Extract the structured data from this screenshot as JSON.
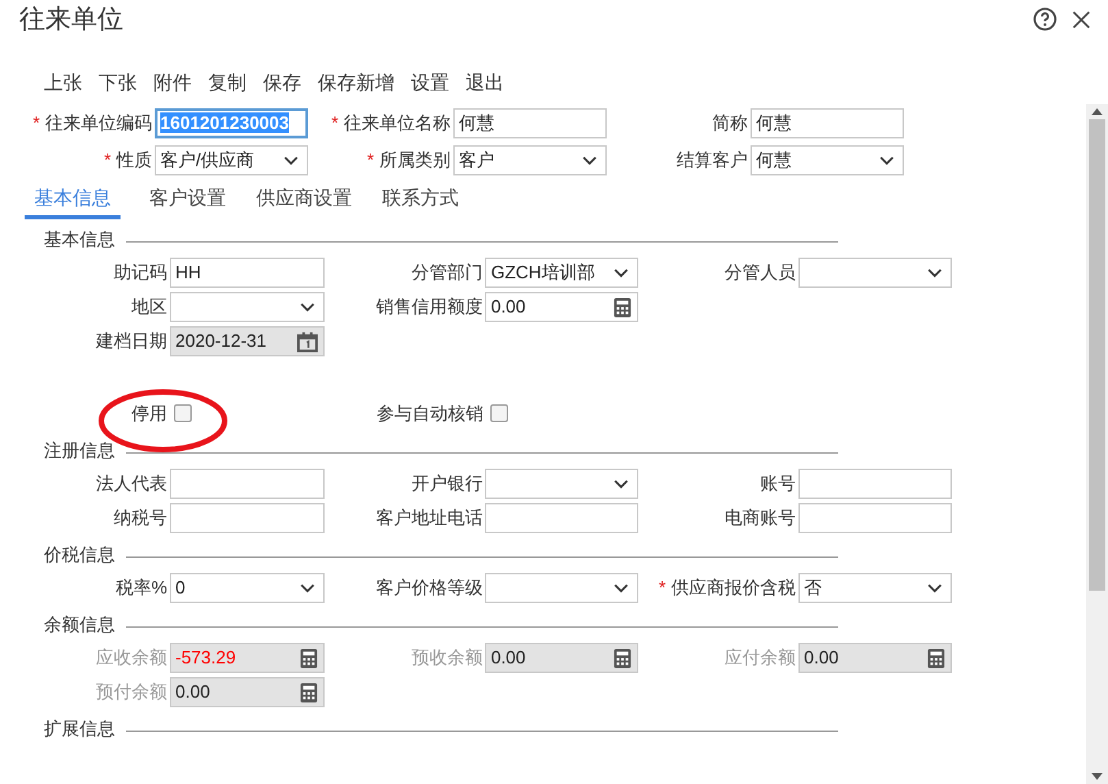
{
  "window": {
    "title": "往来单位"
  },
  "toolbar": [
    "上张",
    "下张",
    "附件",
    "复制",
    "保存",
    "保存新增",
    "设置",
    "退出"
  ],
  "header_rows": [
    [
      {
        "label": "往来单位编码",
        "required_mark": "*",
        "kind": "text",
        "value": "1601201230003",
        "focused": true
      },
      {
        "label": "往来单位名称",
        "required_mark": "*",
        "kind": "text",
        "value": "何慧",
        "focused": false
      },
      {
        "label": "简称",
        "kind": "text",
        "value": "何慧",
        "focused": false
      }
    ],
    [
      {
        "label": "性质",
        "required_mark": "*",
        "kind": "select",
        "value": "客户/供应商",
        "focused": false
      },
      {
        "label": "所属类别",
        "required_mark": "*",
        "kind": "select",
        "value": "客户",
        "focused": false
      },
      {
        "label": "结算客户",
        "kind": "select",
        "value": "何慧",
        "focused": false
      }
    ]
  ],
  "tabs": [
    {
      "label": "基本信息",
      "selected": true
    },
    {
      "label": "客户设置",
      "selected": false
    },
    {
      "label": "供应商设置",
      "selected": false
    },
    {
      "label": "联系方式",
      "selected": false
    }
  ],
  "sections": [
    {
      "title": "基本信息",
      "rows": [
        [
          {
            "label": "助记码",
            "kind": "text",
            "value": "HH",
            "disabled": false
          },
          {
            "label": "分管部门",
            "kind": "select",
            "value": "GZCH培训部",
            "disabled": false
          },
          {
            "label": "分管人员",
            "kind": "select",
            "disabled": false
          }
        ],
        [
          {
            "label": "地区",
            "kind": "select",
            "disabled": false
          },
          {
            "label": "销售信用额度",
            "kind": "calc",
            "value": "0.00",
            "disabled": false
          }
        ],
        [
          {
            "label": "建档日期",
            "kind": "date",
            "value": "2020-12-31",
            "disabled": true
          }
        ],
        [
          {
            "label": "停用",
            "kind": "checkbox",
            "checked": false,
            "disabled": false
          },
          {
            "label": "参与自动核销",
            "kind": "checkbox",
            "checked": false,
            "disabled": false
          }
        ]
      ]
    },
    {
      "title": "注册信息",
      "rows": [
        [
          {
            "label": "法人代表",
            "kind": "text",
            "disabled": false
          },
          {
            "label": "开户银行",
            "kind": "select",
            "disabled": false
          },
          {
            "label": "账号",
            "kind": "text",
            "disabled": false
          }
        ],
        [
          {
            "label": "纳税号",
            "kind": "text",
            "disabled": false
          },
          {
            "label": "客户地址电话",
            "kind": "text",
            "disabled": false
          },
          {
            "label": "电商账号",
            "kind": "text",
            "disabled": false
          }
        ]
      ]
    },
    {
      "title": "价税信息",
      "rows": [
        [
          {
            "label": "税率%",
            "kind": "select",
            "value": "0",
            "disabled": false
          },
          {
            "label": "客户价格等级",
            "kind": "select",
            "disabled": false
          },
          {
            "label": "供应商报价含税",
            "required_mark": "*",
            "kind": "select",
            "value": "否",
            "disabled": false
          }
        ]
      ]
    },
    {
      "title": "余额信息",
      "rows": [
        [
          {
            "label": "应收余额",
            "kind": "calc",
            "value": "-573.29",
            "color": "#ff0000",
            "disabled": true
          },
          {
            "label": "预收余额",
            "kind": "calc",
            "value": "0.00",
            "disabled": true
          },
          {
            "label": "应付余额",
            "kind": "calc",
            "value": "0.00",
            "disabled": true
          }
        ],
        [
          {
            "label": "预付余额",
            "kind": "calc",
            "value": "0.00",
            "disabled": true
          }
        ]
      ]
    },
    {
      "title": "扩展信息"
    }
  ]
}
